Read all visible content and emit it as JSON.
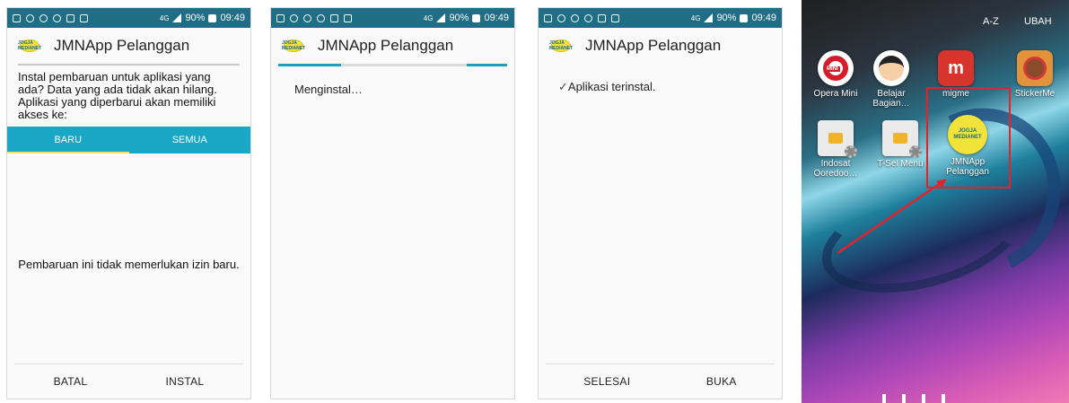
{
  "statusbar": {
    "battery": "90%",
    "time": "09:49",
    "network": "4G"
  },
  "app": {
    "title": "JMNApp Pelanggan",
    "logo_text": "JOGJA MEDIANET"
  },
  "screen1": {
    "description": "Instal pembaruan untuk aplikasi yang ada? Data yang ada tidak akan hilang. Aplikasi yang diperbarui akan memiliki akses ke:",
    "tabs": [
      {
        "label": "BARU",
        "active": true
      },
      {
        "label": "SEMUA",
        "active": false
      }
    ],
    "permission_note": "Pembaruan ini tidak memerlukan izin baru.",
    "buttons": {
      "cancel": "BATAL",
      "install": "INSTAL"
    }
  },
  "screen2": {
    "status": "Menginstal…"
  },
  "screen3": {
    "status": "Aplikasi terinstal.",
    "buttons": {
      "done": "SELESAI",
      "open": "BUKA"
    }
  },
  "homescreen": {
    "top_buttons": {
      "az": "A-Z",
      "edit": "UBAH"
    },
    "apps": [
      {
        "label": "Opera Mini",
        "icon": "opera-mini-icon"
      },
      {
        "label": "Belajar Bagian…",
        "icon": "belajar-icon"
      },
      {
        "label": "migme",
        "icon": "migme-icon"
      },
      {
        "label": "StickerMe",
        "icon": "stickerme-icon"
      },
      {
        "label": "Indosat Ooredoo…",
        "icon": "indosat-sim-icon"
      },
      {
        "label": "T-Sel Menu",
        "icon": "tsel-sim-icon"
      },
      {
        "label": "JMNApp Pelanggan",
        "icon": "jmnapp-icon"
      }
    ],
    "opera_badge": "MINI",
    "migme_letter": "m"
  },
  "colors": {
    "accent": "#1aa6c5",
    "statusbar": "#1f6e86",
    "highlight": "#e5212a"
  }
}
